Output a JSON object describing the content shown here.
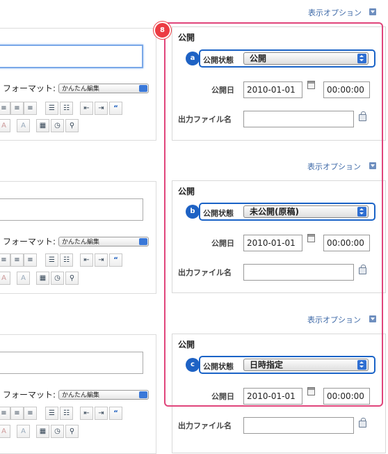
{
  "options_label": "表示オプション",
  "format_label": "フォーマット:",
  "format_value": "かんたん編集",
  "publish_title": "公開",
  "status_label": "公開状態",
  "date_label": "公開日",
  "output_label": "出力ファイル名",
  "frame_badge": "8",
  "panels": [
    {
      "badge": "a",
      "status": "公開",
      "date": "2010-01-01",
      "time": "00:00:00"
    },
    {
      "badge": "b",
      "status": "未公開(原稿)",
      "date": "2010-01-01",
      "time": "00:00:00"
    },
    {
      "badge": "c",
      "status": "日時指定",
      "date": "2010-01-01",
      "time": "00:00:00"
    }
  ],
  "colors": {
    "highlight": "#e0457b",
    "badge_blue": "#1e62c4",
    "link": "#3f6aa8"
  }
}
